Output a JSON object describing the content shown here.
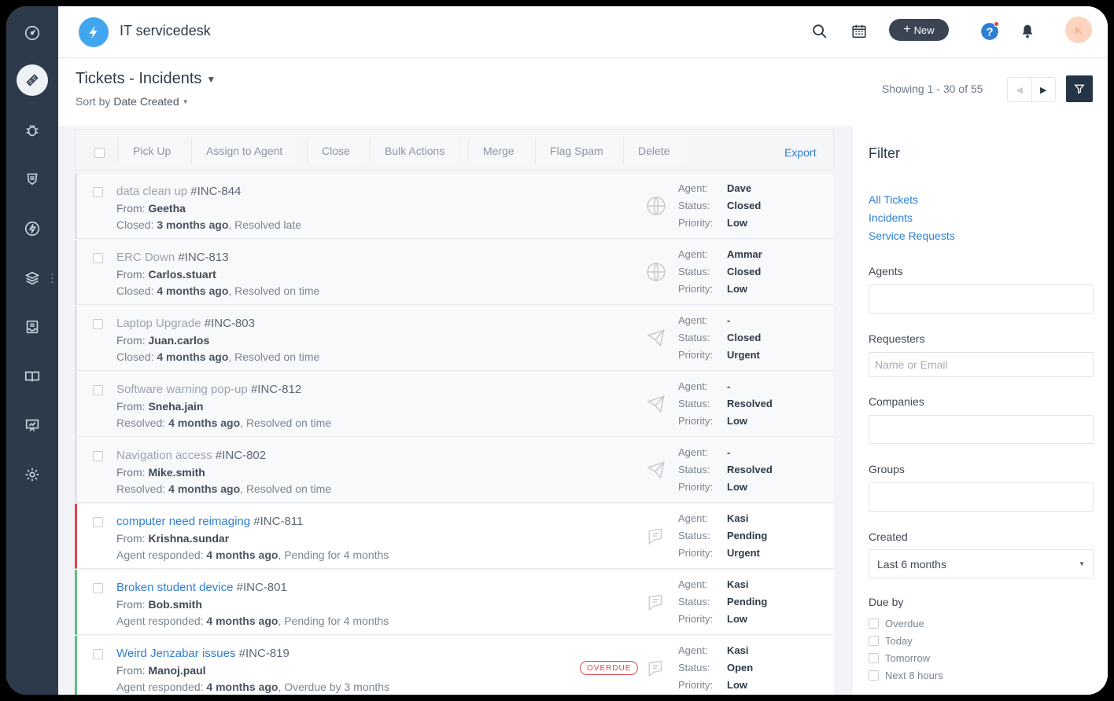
{
  "app": {
    "title": "IT servicedesk",
    "new_label": "New",
    "avatar_initial": "K"
  },
  "rail": {
    "icons": [
      "dashboard-icon",
      "tickets-icon",
      "problems-icon",
      "changes-icon",
      "releases-icon",
      "assets-icon",
      "inbox-icon",
      "solutions-icon",
      "reports-icon",
      "settings-icon"
    ]
  },
  "header": {
    "title": "Tickets - Incidents",
    "sort_prefix": "Sort by",
    "sort_value": "Date Created",
    "showing": "Showing 1 - 30 of 55"
  },
  "toolbar": {
    "buttons": [
      "Pick Up",
      "Assign to Agent",
      "Close",
      "Bulk Actions",
      "Merge",
      "Flag Spam",
      "Delete"
    ],
    "export": "Export"
  },
  "labels": {
    "from": "From:",
    "agent": "Agent:",
    "status": "Status:",
    "priority": "Priority:",
    "overdue": "OVERDUE"
  },
  "tickets": [
    {
      "subject": "data clean up",
      "id": "#INC-844",
      "from": "Geetha",
      "meta_label": "Closed:",
      "meta_time": "3 months ago",
      "meta_tail": ", Resolved late",
      "agent": "Dave",
      "status": "Closed",
      "priority": "Low"
    },
    {
      "subject": "ERC Down",
      "id": "#INC-813",
      "from": "Carlos.stuart",
      "meta_label": "Closed:",
      "meta_time": "4 months ago",
      "meta_tail": ", Resolved on time",
      "agent": "Ammar",
      "status": "Closed",
      "priority": "Low"
    },
    {
      "subject": "Laptop Upgrade",
      "id": "#INC-803",
      "from": "Juan.carlos",
      "meta_label": "Closed:",
      "meta_time": "4 months ago",
      "meta_tail": ", Resolved on time",
      "agent": "-",
      "status": "Closed",
      "priority": "Urgent"
    },
    {
      "subject": "Software warning pop-up",
      "id": "#INC-812",
      "from": "Sneha.jain",
      "meta_label": "Resolved:",
      "meta_time": "4 months ago",
      "meta_tail": ", Resolved on time",
      "agent": "-",
      "status": "Resolved",
      "priority": "Low"
    },
    {
      "subject": "Navigation access",
      "id": "#INC-802",
      "from": "Mike.smith",
      "meta_label": "Resolved:",
      "meta_time": "4 months ago",
      "meta_tail": ", Resolved on time",
      "agent": "-",
      "status": "Resolved",
      "priority": "Low"
    },
    {
      "subject": "computer need reimaging",
      "id": "#INC-811",
      "from": "Krishna.sundar",
      "meta_label": "Agent responded:",
      "meta_time": "4 months ago",
      "meta_tail": ", Pending for 4 months",
      "agent": "Kasi",
      "status": "Pending",
      "priority": "Urgent"
    },
    {
      "subject": "Broken student device",
      "id": "#INC-801",
      "from": "Bob.smith",
      "meta_label": "Agent responded:",
      "meta_time": "4 months ago",
      "meta_tail": ", Pending for 4 months",
      "agent": "Kasi",
      "status": "Pending",
      "priority": "Low"
    },
    {
      "subject": "Weird Jenzabar issues",
      "id": "#INC-819",
      "from": "Manoj.paul",
      "meta_label": "Agent responded:",
      "meta_time": "4 months ago",
      "meta_tail": ", Overdue by 3 months",
      "agent": "Kasi",
      "status": "Open",
      "priority": "Low"
    }
  ],
  "filter": {
    "title": "Filter",
    "links": [
      "All Tickets",
      "Incidents",
      "Service Requests"
    ],
    "agents_label": "Agents",
    "requesters_label": "Requesters",
    "requesters_placeholder": "Name or Email",
    "companies_label": "Companies",
    "groups_label": "Groups",
    "created_label": "Created",
    "created_value": "Last 6 months",
    "due_label": "Due by",
    "due_options": [
      "Overdue",
      "Today",
      "Tomorrow",
      "Next 8 hours"
    ]
  },
  "colors": {
    "rail": "#2c3a4b",
    "accent": "#2d7fd5",
    "overdue": "#e3454a",
    "pending": "#5fc07f"
  }
}
